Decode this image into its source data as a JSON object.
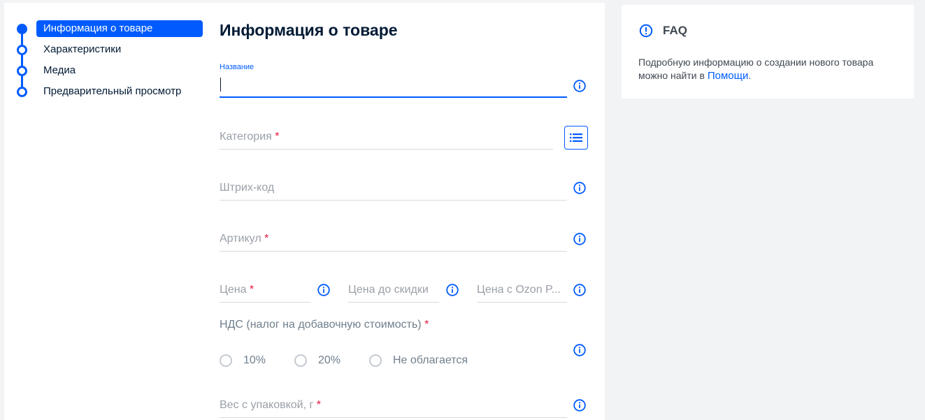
{
  "stepper": {
    "items": [
      {
        "label": "Информация о товаре",
        "active": true
      },
      {
        "label": "Характеристики",
        "active": false
      },
      {
        "label": "Медиа",
        "active": false
      },
      {
        "label": "Предварительный просмотр",
        "active": false
      }
    ]
  },
  "form": {
    "title": "Информация о товаре",
    "name": {
      "label": "Название",
      "value": ""
    },
    "category": {
      "label": "Категория",
      "required": "*",
      "button_icon": "list-icon"
    },
    "barcode": {
      "label": "Штрих-код"
    },
    "article": {
      "label": "Артикул",
      "required": "*"
    },
    "price": {
      "label": "Цена",
      "required": "*"
    },
    "price_before_discount": {
      "label": "Цена до скидки"
    },
    "price_ozon": {
      "label": "Цена с Ozon P..."
    },
    "vat": {
      "label": "НДС (налог на добавочную стоимость)",
      "required": "*",
      "options": [
        "10%",
        "20%",
        "Не облагается"
      ]
    },
    "weight": {
      "label": "Вес с упаковкой, г",
      "required": "*"
    }
  },
  "faq": {
    "title": "FAQ",
    "text_prefix": "Подробную информацию о создании нового товара можно найти в ",
    "link": "Помощи",
    "text_suffix": "."
  },
  "colors": {
    "accent": "#005bff",
    "required": "#e3173e",
    "background": "#f2f3f5"
  }
}
